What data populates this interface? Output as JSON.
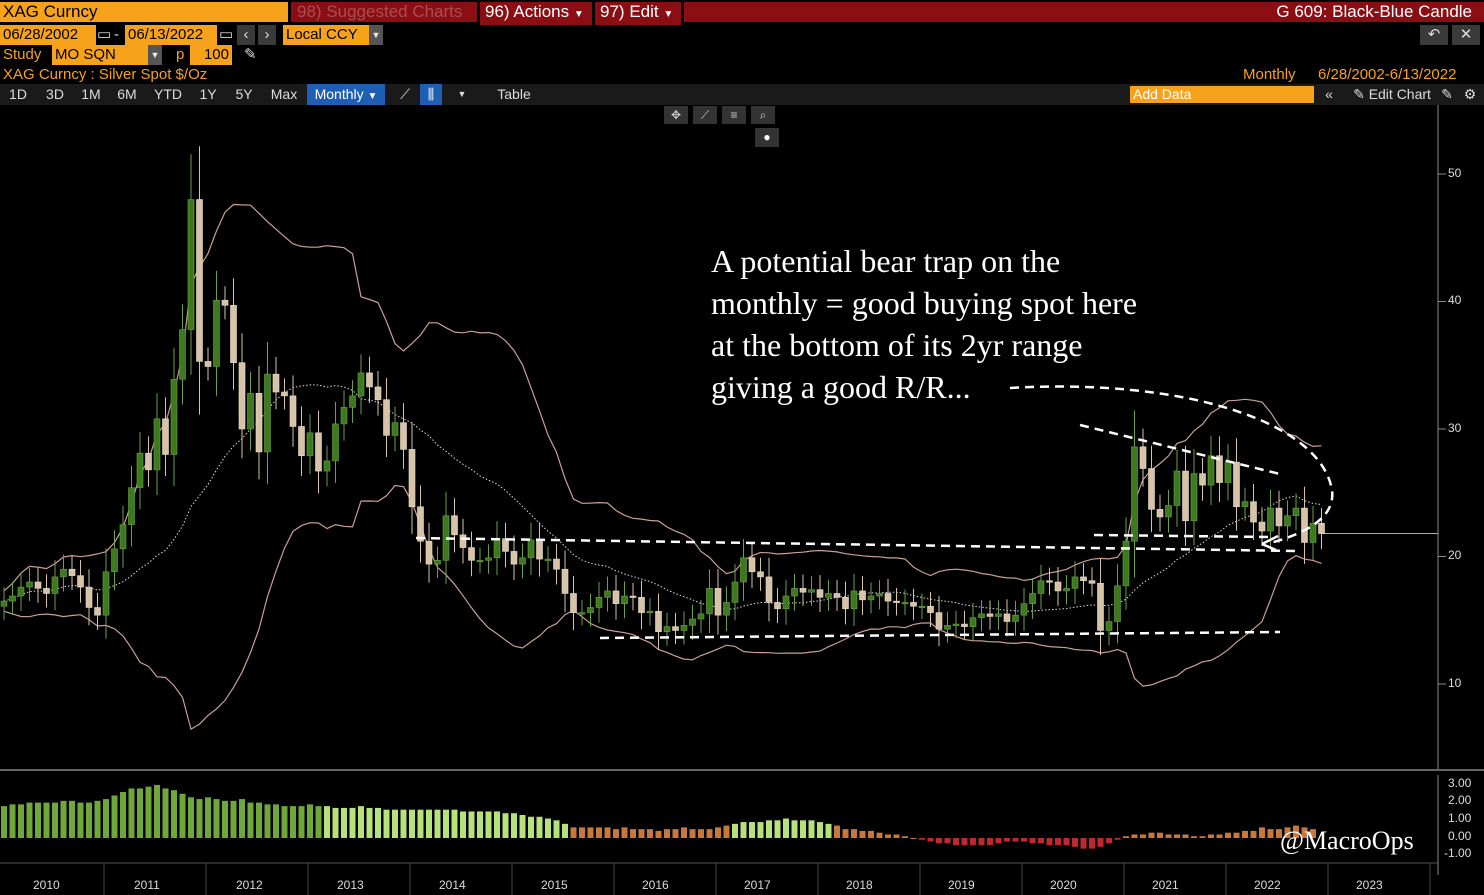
{
  "header": {
    "security": "XAG Curncy",
    "suggested": "Suggested Charts",
    "suggested_num": "98)",
    "actions": "Actions",
    "actions_num": "96)",
    "edit": "Edit",
    "edit_num": "97)",
    "chart_name": "G 609: Black-Blue Candle"
  },
  "dates": {
    "start": "06/28/2002",
    "separator": "-",
    "end": "06/13/2022",
    "currency": "Local CCY"
  },
  "study": {
    "label": "Study",
    "value": "MO SQN",
    "p_label": "p",
    "p_value": "100"
  },
  "info": {
    "title": "XAG Curncy : Silver Spot  $/Oz",
    "period": "Monthly",
    "range": "6/28/2002-6/13/2022"
  },
  "toolbar": {
    "periods": [
      "1D",
      "3D",
      "1M",
      "6M",
      "YTD",
      "1Y",
      "5Y",
      "Max"
    ],
    "selected": "Monthly",
    "table": "Table",
    "add_data_placeholder": "Add Data",
    "edit_chart": "Edit Chart"
  },
  "annotation": {
    "line1": "A potential bear trap on the",
    "line2": "monthly = good buying spot here",
    "line3": "at the bottom of its 2yr range",
    "line4": "giving a good R/R..."
  },
  "watermark": "@MacroOps",
  "colors": {
    "up": "#3d7a1e",
    "down": "#d6c3a8",
    "osc_green": "#6fa83a",
    "osc_light": "#b5e27a",
    "osc_orange": "#c8783a",
    "osc_red": "#c0282f",
    "band": "#c99f97",
    "accent": "#f7a21b"
  },
  "chart_data": {
    "type": "candlestick",
    "y_ticks": [
      "50",
      "40",
      "30",
      "20",
      "10"
    ],
    "osc_ticks": [
      "3.00",
      "2.00",
      "1.00",
      "0.00",
      "-1.00"
    ],
    "x_ticks": [
      "2010",
      "2011",
      "2012",
      "2013",
      "2014",
      "2015",
      "2016",
      "2017",
      "2018",
      "2019",
      "2020",
      "2021",
      "2022",
      "2023"
    ],
    "x_range": [
      "2009-07",
      "2023-09"
    ],
    "y_range": [
      5,
      55
    ],
    "osc_range": [
      -1.5,
      3.5
    ],
    "closes": [
      16.5,
      16.9,
      17.6,
      18.0,
      17.5,
      17.1,
      18.4,
      19.0,
      18.5,
      17.6,
      16.0,
      15.4,
      18.8,
      20.6,
      22.5,
      25.4,
      28.1,
      26.8,
      30.8,
      28.0,
      33.9,
      37.8,
      48.0,
      35.3,
      34.9,
      40.1,
      39.7,
      35.2,
      30.0,
      32.8,
      28.2,
      34.3,
      32.9,
      32.6,
      30.2,
      27.9,
      29.7,
      26.7,
      27.5,
      30.4,
      31.7,
      32.6,
      34.4,
      33.3,
      32.3,
      29.5,
      30.5,
      28.4,
      23.9,
      21.2,
      19.4,
      19.7,
      23.2,
      21.7,
      20.7,
      19.7,
      19.7,
      19.9,
      21.4,
      20.4,
      19.4,
      19.9,
      21.3,
      19.8,
      19.8,
      19.0,
      17.1,
      15.6,
      15.6,
      16.0,
      16.8,
      17.3,
      16.3,
      16.9,
      16.8,
      15.6,
      15.7,
      14.1,
      14.5,
      14.2,
      14.6,
      15.1,
      15.5,
      17.5,
      15.4,
      16.4,
      18.0,
      19.9,
      18.8,
      18.4,
      16.4,
      15.9,
      16.9,
      17.5,
      17.2,
      17.4,
      16.8,
      17.1,
      16.8,
      15.9,
      17.3,
      16.6,
      16.9,
      17.1,
      16.5,
      16.4,
      16.4,
      16.1,
      16.1,
      15.6,
      14.3,
      14.6,
      14.7,
      14.5,
      15.2,
      15.5,
      15.3,
      15.5,
      14.9,
      15.4,
      16.3,
      17.1,
      18.1,
      18.0,
      17.3,
      17.5,
      18.4,
      18.1,
      17.9,
      14.2,
      14.9,
      17.7,
      21.2,
      28.6,
      26.9,
      23.7,
      23.1,
      24.0,
      26.7,
      22.8,
      26.5,
      25.6,
      27.9,
      25.8,
      27.4,
      23.9,
      24.3,
      22.7,
      22.0,
      23.8,
      22.4,
      23.2,
      23.8,
      21.1,
      22.6,
      21.8
    ],
    "oscillator": [
      1.8,
      1.9,
      1.9,
      2.0,
      2.0,
      2.0,
      2.0,
      2.1,
      2.1,
      2.0,
      2.0,
      2.1,
      2.2,
      2.4,
      2.6,
      2.8,
      2.8,
      2.9,
      3.0,
      2.8,
      2.7,
      2.5,
      2.3,
      2.2,
      2.3,
      2.2,
      2.1,
      2.1,
      2.2,
      2.0,
      2.0,
      1.9,
      1.9,
      1.8,
      1.8,
      1.8,
      1.9,
      1.8,
      1.8,
      1.7,
      1.7,
      1.7,
      1.8,
      1.7,
      1.7,
      1.6,
      1.6,
      1.6,
      1.6,
      1.6,
      1.6,
      1.6,
      1.6,
      1.6,
      1.5,
      1.5,
      1.5,
      1.5,
      1.5,
      1.4,
      1.4,
      1.3,
      1.2,
      1.2,
      1.1,
      1.0,
      0.8,
      0.6,
      0.6,
      0.6,
      0.6,
      0.6,
      0.5,
      0.6,
      0.5,
      0.5,
      0.5,
      0.4,
      0.5,
      0.5,
      0.6,
      0.5,
      0.5,
      0.5,
      0.6,
      0.7,
      0.8,
      0.9,
      0.9,
      0.9,
      1.0,
      1.0,
      1.1,
      1.0,
      1.0,
      1.0,
      0.9,
      0.8,
      0.7,
      0.5,
      0.5,
      0.4,
      0.4,
      0.3,
      0.2,
      0.2,
      0.1,
      0.0,
      -0.1,
      -0.2,
      -0.3,
      -0.3,
      -0.4,
      -0.4,
      -0.4,
      -0.4,
      -0.4,
      -0.3,
      -0.2,
      -0.2,
      -0.2,
      -0.3,
      -0.3,
      -0.4,
      -0.4,
      -0.4,
      -0.5,
      -0.6,
      -0.6,
      -0.5,
      -0.3,
      -0.1,
      0.1,
      0.2,
      0.2,
      0.3,
      0.3,
      0.2,
      0.2,
      0.2,
      0.1,
      0.1,
      0.2,
      0.2,
      0.3,
      0.3,
      0.4,
      0.4,
      0.6,
      0.5,
      0.5,
      0.6,
      0.7,
      0.6,
      0.5
    ]
  }
}
